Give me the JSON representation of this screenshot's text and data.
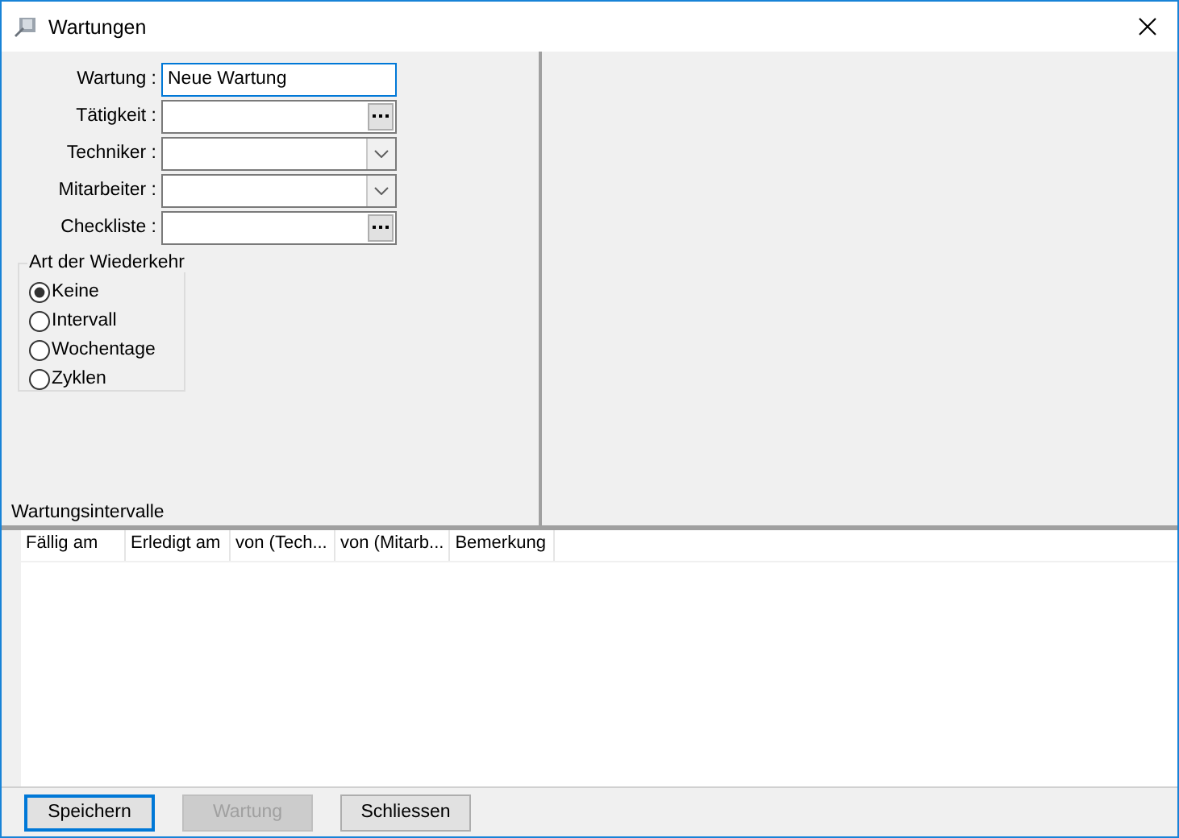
{
  "window": {
    "title": "Wartungen"
  },
  "form": {
    "fields": [
      {
        "label": "Wartung :",
        "kind": "text",
        "value": "Neue Wartung",
        "focused": true
      },
      {
        "label": "Tätigkeit :",
        "kind": "lookup",
        "focused": false
      },
      {
        "label": "Techniker :",
        "kind": "combo",
        "focused": false
      },
      {
        "label": "Mitarbeiter :",
        "kind": "combo",
        "focused": false
      },
      {
        "label": "Checkliste :",
        "kind": "lookup",
        "focused": false
      }
    ],
    "recurrence": {
      "title": "Art der Wiederkehr",
      "options": [
        {
          "label": "Keine",
          "selected": true
        },
        {
          "label": "Intervall",
          "selected": false
        },
        {
          "label": "Wochentage",
          "selected": false
        },
        {
          "label": "Zyklen",
          "selected": false
        }
      ]
    },
    "section_label": "Wartungsintervalle"
  },
  "table": {
    "columns": [
      "Fällig am",
      "Erledigt am",
      "von (Tech...",
      "von (Mitarb...",
      "Bemerkung"
    ]
  },
  "buttons": [
    {
      "label": "Speichern",
      "disabled": false,
      "focused": true
    },
    {
      "label": "Wartung",
      "disabled": true,
      "focused": false
    },
    {
      "label": "Schliessen",
      "disabled": false,
      "focused": false
    }
  ]
}
